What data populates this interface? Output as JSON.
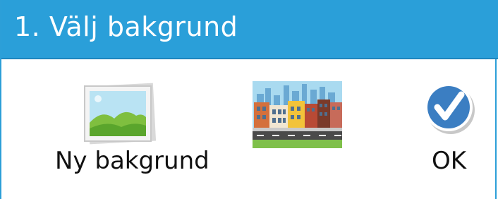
{
  "dialog": {
    "title": "1. Välj bakgrund"
  },
  "options": {
    "new_background": {
      "label": "Ny bakgrund",
      "icon": "landscape-photo-icon"
    },
    "city_background": {
      "icon": "city-street-thumbnail"
    },
    "ok": {
      "label": "OK",
      "icon": "checkmark-circle-icon"
    }
  },
  "colors": {
    "header": "#2a9fd9",
    "ok_circle": "#3b7ec2",
    "text": "#111111"
  }
}
